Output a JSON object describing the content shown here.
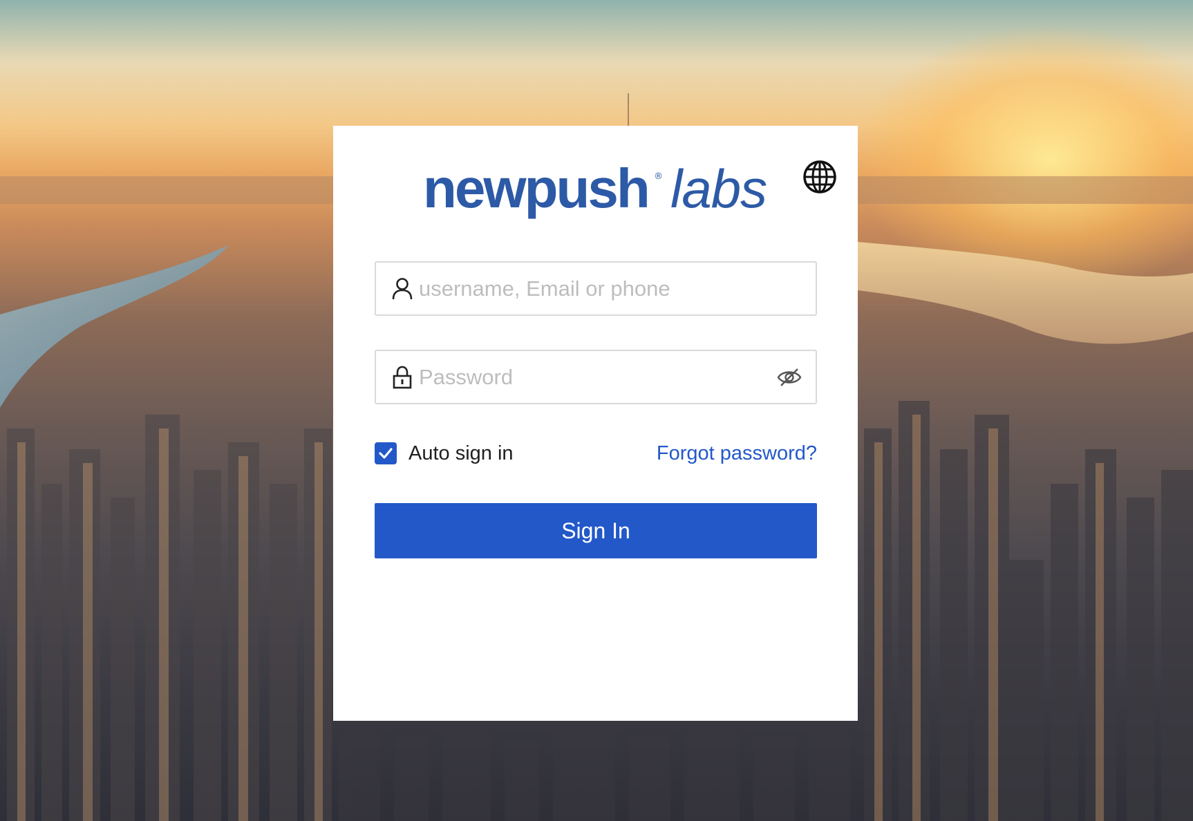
{
  "brand": {
    "name": "newpush",
    "registered_mark": "®",
    "suffix": "labs",
    "color": "#2d5aa6"
  },
  "language": {
    "icon": "globe-icon"
  },
  "login": {
    "username_placeholder": "username, Email or phone",
    "username_icon": "user-icon",
    "password_placeholder": "Password",
    "password_icon": "lock-icon",
    "visibility_icon": "eye-slash-icon",
    "auto_sign_in_label": "Auto sign in",
    "auto_sign_in_checked": true,
    "forgot_password_label": "Forgot password?",
    "sign_in_label": "Sign In"
  },
  "colors": {
    "primary": "#2358c9",
    "card_background": "#ffffff"
  },
  "background": {
    "description_icon": "city-skyline-background"
  }
}
